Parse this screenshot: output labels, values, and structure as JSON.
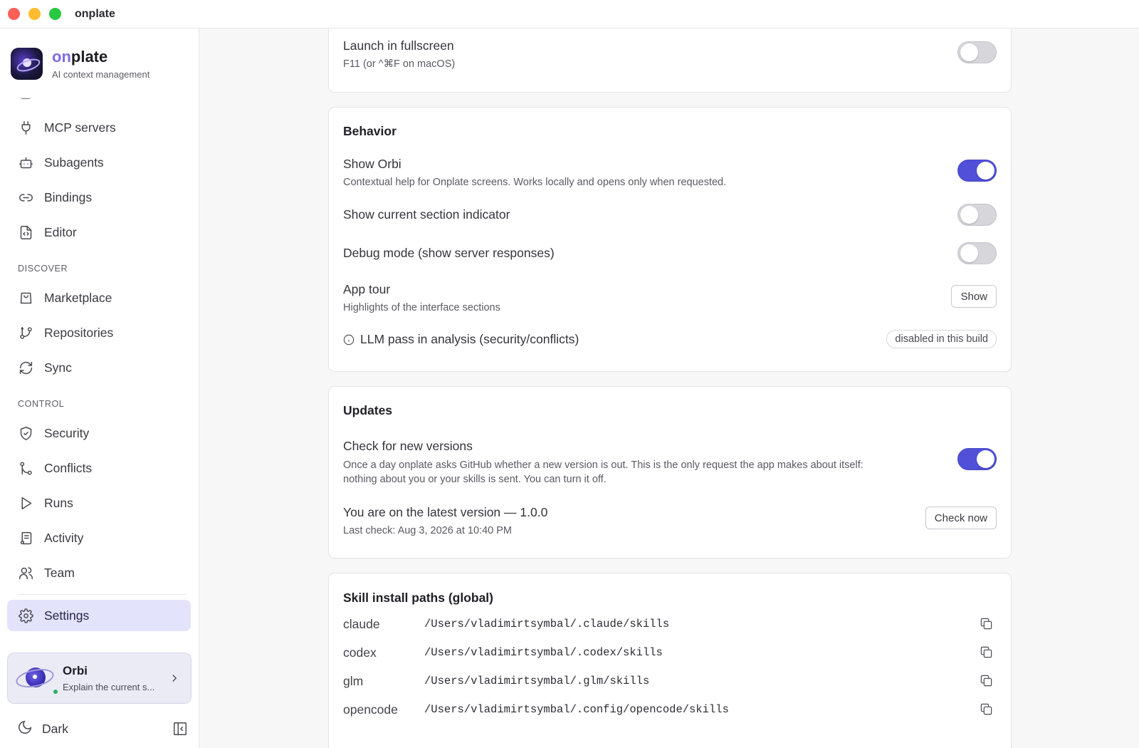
{
  "window": {
    "title": "onplate"
  },
  "brand": {
    "name_accent": "on",
    "name_rest": "plate",
    "subtitle": "AI context management"
  },
  "sidebar": {
    "items_top": [
      {
        "label": "MCP servers",
        "icon": "plug-icon"
      },
      {
        "label": "Subagents",
        "icon": "bot-icon"
      },
      {
        "label": "Bindings",
        "icon": "link-icon"
      },
      {
        "label": "Editor",
        "icon": "file-code-icon"
      }
    ],
    "section_discover": "DISCOVER",
    "items_discover": [
      {
        "label": "Marketplace",
        "icon": "shopping-bag-icon"
      },
      {
        "label": "Repositories",
        "icon": "git-branch-icon"
      },
      {
        "label": "Sync",
        "icon": "refresh-icon"
      }
    ],
    "section_control": "CONTROL",
    "items_control": [
      {
        "label": "Security",
        "icon": "shield-check-icon"
      },
      {
        "label": "Conflicts",
        "icon": "git-merge-icon"
      },
      {
        "label": "Runs",
        "icon": "play-icon"
      },
      {
        "label": "Activity",
        "icon": "scroll-icon"
      },
      {
        "label": "Team",
        "icon": "users-icon"
      }
    ],
    "settings_label": "Settings",
    "orbi": {
      "name": "Orbi",
      "subtitle": "Explain the current s..."
    },
    "theme_label": "Dark"
  },
  "display": {
    "fullscreen_title": "Launch in fullscreen",
    "fullscreen_desc": "F11 (or ^⌘F on macOS)",
    "fullscreen_on": false
  },
  "behavior": {
    "title": "Behavior",
    "show_orbi_title": "Show Orbi",
    "show_orbi_desc": "Contextual help for Onplate screens. Works locally and opens only when requested.",
    "show_orbi_on": true,
    "section_indicator_title": "Show current section indicator",
    "section_indicator_on": false,
    "debug_title": "Debug mode (show server responses)",
    "debug_on": false,
    "tour_title": "App tour",
    "tour_desc": "Highlights of the interface sections",
    "tour_button": "Show",
    "llm_title": "LLM pass in analysis (security/conflicts)",
    "llm_badge": "disabled in this build"
  },
  "updates": {
    "title": "Updates",
    "check_title": "Check for new versions",
    "check_desc_1": "Once a day onplate asks GitHub whether a new version is out. This is the only request the app makes about itself:",
    "check_desc_2": "nothing about you or your skills is sent. You can turn it off.",
    "check_on": true,
    "version_title": "You are on the latest version — 1.0.0",
    "last_check": "Last check: Aug 3, 2026 at 10:40 PM",
    "check_button": "Check now"
  },
  "paths": {
    "title": "Skill install paths (global)",
    "rows": [
      {
        "name": "claude",
        "path": "/Users/vladimirtsymbal/.claude/skills"
      },
      {
        "name": "codex",
        "path": "/Users/vladimirtsymbal/.codex/skills"
      },
      {
        "name": "glm",
        "path": "/Users/vladimirtsymbal/.glm/skills"
      },
      {
        "name": "opencode",
        "path": "/Users/vladimirtsymbal/.config/opencode/skills"
      }
    ]
  }
}
